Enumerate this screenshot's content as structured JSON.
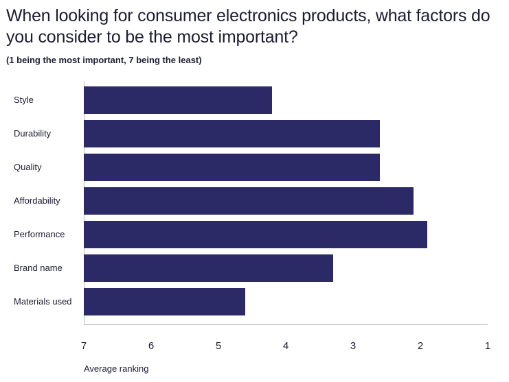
{
  "chart_data": {
    "type": "bar",
    "orientation": "horizontal",
    "title": "When looking for consumer electronics products, what factors do you consider to be the most important?",
    "subtitle": "(1 being the most important, 7 being the least)",
    "xlabel": "Average ranking",
    "ylabel": "",
    "categories": [
      "Style",
      "Durability",
      "Quality",
      "Affordability",
      "Performance",
      "Brand name",
      "Materials used"
    ],
    "values": [
      4.2,
      2.6,
      2.6,
      2.1,
      1.9,
      3.3,
      4.6
    ],
    "series": [
      {
        "name": "Average ranking",
        "values": [
          4.2,
          2.6,
          2.6,
          2.1,
          1.9,
          3.3,
          4.6
        ]
      }
    ],
    "xlim": [
      7,
      1
    ],
    "x_axis_reversed": true,
    "xticks": [
      7,
      6,
      5,
      4,
      3,
      2,
      1
    ],
    "xtick_labels": [
      "7",
      "6",
      "5",
      "4",
      "3",
      "2",
      "1"
    ],
    "grid": false,
    "legend": false,
    "legend_position": "none",
    "bar_color": "#2b2a66",
    "axis_color": "#b7b7b7",
    "text_color": "#1c1c33",
    "background": "#ffffff"
  }
}
